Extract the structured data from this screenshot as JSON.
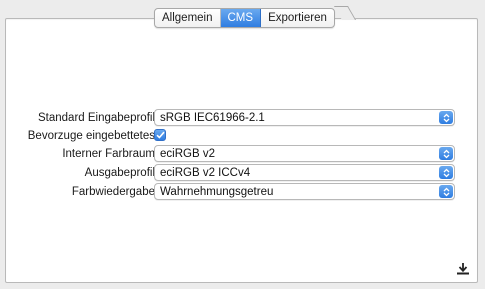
{
  "tabs": [
    {
      "label": "Allgemein",
      "active": false
    },
    {
      "label": "CMS",
      "active": true
    },
    {
      "label": "Exportieren",
      "active": false
    }
  ],
  "form": {
    "standard_input_profile": {
      "label": "Standard Eingabeprofil",
      "value": "sRGB IEC61966-2.1"
    },
    "prefer_embedded": {
      "label": "Bevorzuge eingebettetes",
      "checked": true
    },
    "internal_color_space": {
      "label": "Interner Farbraum",
      "value": "eciRGB v2"
    },
    "output_profile": {
      "label": "Ausgabeprofil",
      "value": "eciRGB v2 ICCv4"
    },
    "rendering_intent": {
      "label": "Farbwiedergabe",
      "value": "Wahrnehmungsgetreu"
    }
  },
  "icons": {
    "select_arrow": "updown-chevron-icon",
    "checkmark": "checkmark-icon",
    "download": "download-icon"
  },
  "colors": {
    "accent": "#3a86e6",
    "panel": "#ffffff",
    "background": "#ececec"
  }
}
